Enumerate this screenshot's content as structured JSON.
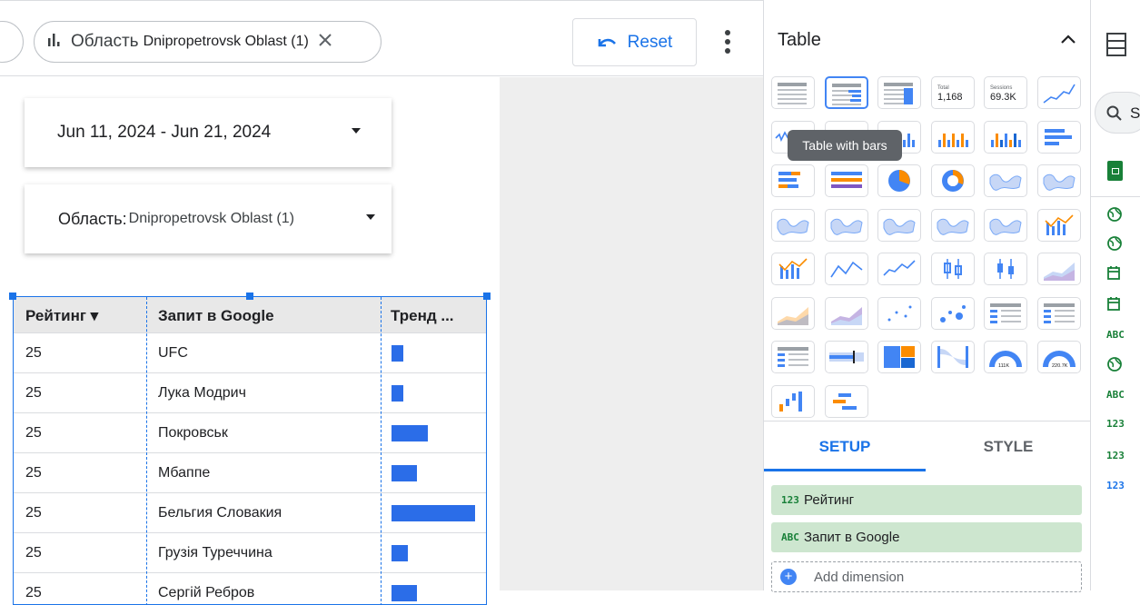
{
  "filter_chip": {
    "label": "Область",
    "value": "Dnipropetrovsk Oblast (1)"
  },
  "toolbar": {
    "reset_label": "Reset"
  },
  "date_range": {
    "value": "Jun 11, 2024 - Jun 21, 2024"
  },
  "region_filter": {
    "label": "Область",
    "separator": ":",
    "value": "Dnipropetrovsk Oblast (1)"
  },
  "table": {
    "columns": [
      "Рейтинг ▾",
      "Запит в Google",
      "Тренд ..."
    ],
    "rows": [
      {
        "rank": "25",
        "query": "UFC",
        "trend": 0.14
      },
      {
        "rank": "25",
        "query": "Лука Модрич",
        "trend": 0.14
      },
      {
        "rank": "25",
        "query": "Покровськ",
        "trend": 0.43
      },
      {
        "rank": "25",
        "query": "Мбаппе",
        "trend": 0.3
      },
      {
        "rank": "25",
        "query": "Бельгия Словакия",
        "trend": 1.0
      },
      {
        "rank": "25",
        "query": "Грузія Туреччина",
        "trend": 0.2
      },
      {
        "rank": "25",
        "query": "Сергій Ребров",
        "trend": 0.3
      }
    ]
  },
  "panel": {
    "title": "Table",
    "tooltip": "Table with bars",
    "scorecard_total": {
      "label": "Total",
      "value": "1,168"
    },
    "scorecard_sessions": {
      "label": "Sessions",
      "value": "69.3K"
    },
    "gauge_1": "111K",
    "gauge_2": "220.7K",
    "tabs": {
      "setup": "SETUP",
      "style": "STYLE"
    },
    "fields": [
      {
        "type": "123",
        "name": "Рейтинг"
      },
      {
        "type": "ABC",
        "name": "Запит в Google"
      }
    ],
    "add_dimension": "Add dimension"
  },
  "strip": {
    "search_letter": "S",
    "field_types": [
      "ABC",
      "ABC",
      "123",
      "123",
      "123"
    ]
  },
  "colors": {
    "accent": "#1a73e8",
    "bar": "#2b6de8",
    "pill": "#cde6cf"
  }
}
